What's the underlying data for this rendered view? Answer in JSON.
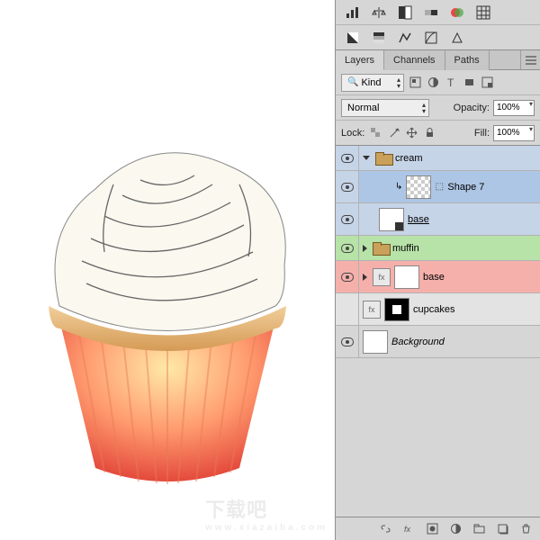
{
  "tabs": {
    "layers": "Layers",
    "channels": "Channels",
    "paths": "Paths"
  },
  "filter": {
    "kind": "Kind"
  },
  "blend": {
    "mode": "Normal",
    "opacity_label": "Opacity:",
    "opacity_value": "100%"
  },
  "lock": {
    "label": "Lock:",
    "fill_label": "Fill:",
    "fill_value": "100%"
  },
  "layers": [
    {
      "name": "cream",
      "type": "group",
      "expanded": true,
      "color": "blue"
    },
    {
      "name": "Shape 7",
      "type": "shape",
      "indent": 2,
      "selected": true,
      "color": "blue",
      "thumb": "checker",
      "link": true
    },
    {
      "name": "base",
      "type": "smart",
      "indent": 1,
      "color": "blue",
      "thumb": "smart",
      "underline": true
    },
    {
      "name": "muffin",
      "type": "group",
      "expanded": false,
      "color": "green"
    },
    {
      "name": "base",
      "type": "layer",
      "indent": 0,
      "color": "red",
      "thumb": "plain",
      "disclosure": true
    },
    {
      "name": "cupcakes",
      "type": "layer",
      "indent": 0,
      "color": "ltgray",
      "thumb": "fx",
      "mask": true
    },
    {
      "name": "Background",
      "type": "bg",
      "indent": 0,
      "color": "gray",
      "italic": true
    }
  ],
  "watermark": {
    "main": "下载吧",
    "sub": "www.xiazaiba.com"
  }
}
